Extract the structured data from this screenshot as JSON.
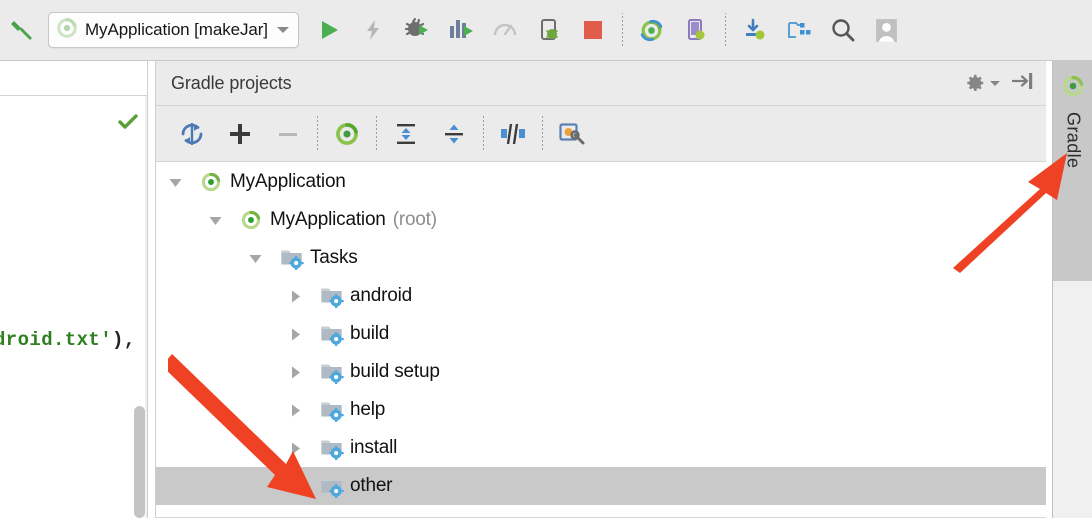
{
  "main_toolbar": {
    "build_icon": "hammer-icon",
    "run_config": {
      "icon": "gradle-run-config-icon",
      "label": "MyApplication [makeJar]",
      "dropdown_icon": "chevron-down-icon"
    },
    "buttons": [
      {
        "name": "run-button",
        "icon": "play-icon"
      },
      {
        "name": "apply-changes-button",
        "icon": "lightning-bolt-icon"
      },
      {
        "name": "debug-button",
        "icon": "debug-bug-icon"
      },
      {
        "name": "profile-button",
        "icon": "profiler-bars-icon"
      },
      {
        "name": "monitor-button",
        "icon": "gauge-icon"
      },
      {
        "name": "attach-debugger-button",
        "icon": "attach-debugger-icon"
      },
      {
        "name": "stop-button",
        "icon": "stop-square-icon"
      },
      {
        "name": "sync-gradle-button",
        "icon": "gradle-sync-icon"
      },
      {
        "name": "avd-manager-button",
        "icon": "avd-manager-icon"
      },
      {
        "name": "sdk-manager-button",
        "icon": "sdk-manager-icon"
      },
      {
        "name": "project-structure-button",
        "icon": "project-structure-icon"
      },
      {
        "name": "search-everywhere-button",
        "icon": "search-icon"
      },
      {
        "name": "account-button",
        "icon": "user-avatar-icon"
      }
    ]
  },
  "editor": {
    "inspection_icon": "green-checkmark-icon",
    "code_fragment": "droid.txt'",
    "code_tail": "),",
    "scrollbar": "editor-scrollbar-thumb"
  },
  "tool_window": {
    "title": "Gradle projects",
    "header_buttons": [
      {
        "name": "settings-gear-button",
        "icon": "gear-icon"
      },
      {
        "name": "hide-panel-button",
        "icon": "hide-right-icon"
      }
    ],
    "toolbar_buttons": [
      {
        "name": "refresh-button",
        "icon": "refresh-sync-icon"
      },
      {
        "name": "add-button",
        "icon": "plus-icon"
      },
      {
        "name": "remove-button",
        "icon": "minus-icon"
      },
      {
        "name": "execute-task-button",
        "icon": "gradle-run-icon"
      },
      {
        "name": "expand-all-button",
        "icon": "expand-all-icon"
      },
      {
        "name": "collapse-all-button",
        "icon": "collapse-all-icon"
      },
      {
        "name": "toggle-offline-button",
        "icon": "offline-mode-icon"
      },
      {
        "name": "gradle-settings-button",
        "icon": "gradle-settings-wrench-icon"
      }
    ],
    "tree": [
      {
        "depth": 0,
        "arrow": "expanded",
        "icon": "gradle-project-icon",
        "label": "MyApplication",
        "suffix": "",
        "selected": false
      },
      {
        "depth": 1,
        "arrow": "expanded",
        "icon": "gradle-project-icon",
        "label": "MyApplication",
        "suffix": "(root)",
        "selected": false
      },
      {
        "depth": 2,
        "arrow": "expanded",
        "icon": "task-folder-icon",
        "label": "Tasks",
        "suffix": "",
        "selected": false
      },
      {
        "depth": 3,
        "arrow": "collapsed",
        "icon": "task-folder-icon",
        "label": "android",
        "suffix": "",
        "selected": false
      },
      {
        "depth": 3,
        "arrow": "collapsed",
        "icon": "task-folder-icon",
        "label": "build",
        "suffix": "",
        "selected": false
      },
      {
        "depth": 3,
        "arrow": "collapsed",
        "icon": "task-folder-icon",
        "label": "build setup",
        "suffix": "",
        "selected": false
      },
      {
        "depth": 3,
        "arrow": "collapsed",
        "icon": "task-folder-icon",
        "label": "help",
        "suffix": "",
        "selected": false
      },
      {
        "depth": 3,
        "arrow": "collapsed",
        "icon": "task-folder-icon",
        "label": "install",
        "suffix": "",
        "selected": false
      },
      {
        "depth": 3,
        "arrow": "expanded",
        "icon": "task-folder-icon",
        "label": "other",
        "suffix": "",
        "selected": true
      }
    ]
  },
  "tab_strip": {
    "icon": "gradle-elephant-icon",
    "label": "Gradle"
  },
  "annotations": {
    "color": "#ef4123",
    "arrows": [
      {
        "name": "arrow-to-gradle-tab",
        "points_to": "gradle-tool-window-tab"
      },
      {
        "name": "arrow-to-other-node",
        "points_to": "tree-node-other"
      }
    ]
  }
}
